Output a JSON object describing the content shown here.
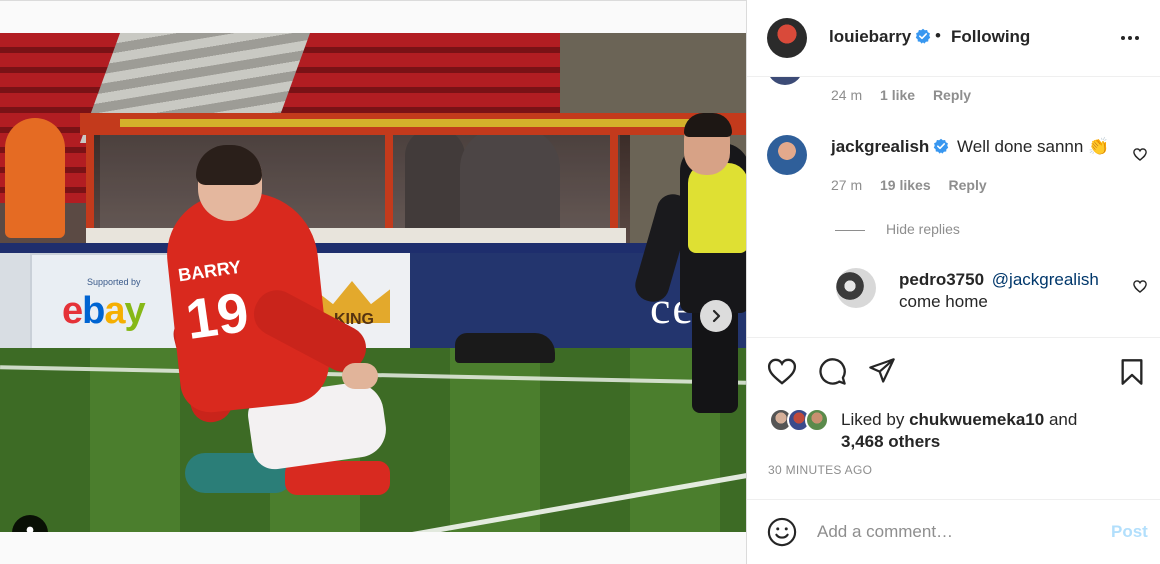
{
  "post": {
    "author": "louiebarry",
    "follow_status": "Following",
    "separator": "•",
    "carousel": {
      "slides": 4,
      "active_index": 0
    }
  },
  "media": {
    "board_supported_by": "Supported by",
    "board_ebay": "ebay",
    "board_king": "KING",
    "board_right": "ce",
    "shirt_name": "BARRY",
    "shirt_number": "19"
  },
  "comments": [
    {
      "time": "24 m",
      "likes": "1 like",
      "reply_label": "Reply"
    },
    {
      "username": "jackgrealish",
      "text": "Well done sannn 👏",
      "time": "27 m",
      "likes": "19 likes",
      "reply_label": "Reply",
      "verified": true
    }
  ],
  "replies_toggle": "Hide replies",
  "replies": [
    {
      "username": "pedro3750",
      "mention": "@jackgrealish",
      "text": "come home"
    }
  ],
  "likes": {
    "prefix": "Liked by",
    "user": "chukwuemeka10",
    "connector": "and",
    "others": "3,468 others"
  },
  "posted_time": "30 MINUTES AGO",
  "add_comment": {
    "placeholder": "Add a comment…",
    "post_label": "Post"
  },
  "colors": {
    "verified": "#3897f0",
    "post_disabled": "#b2dffc",
    "mention": "#00376b",
    "muted": "#8e8e8e"
  },
  "icons": [
    "verified-icon",
    "more-icon",
    "heart-icon",
    "comment-icon",
    "share-icon",
    "bookmark-icon",
    "emoji-icon",
    "chevron-right-icon",
    "user-tag-icon"
  ]
}
